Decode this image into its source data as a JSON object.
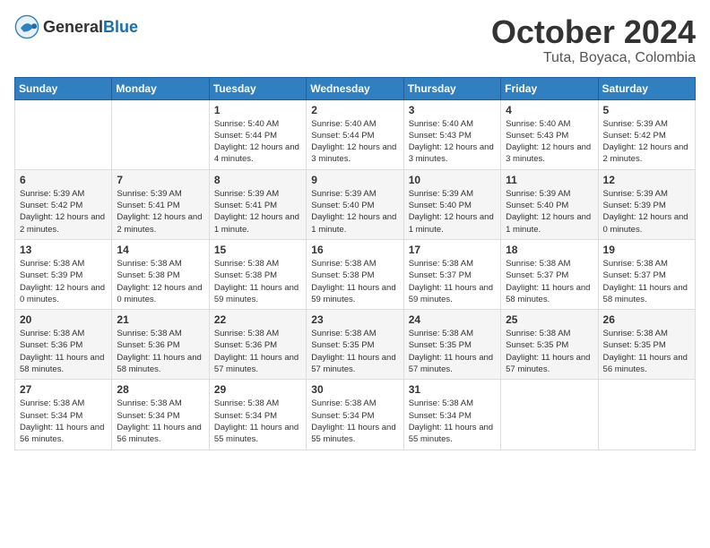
{
  "logo": {
    "general": "General",
    "blue": "Blue"
  },
  "header": {
    "month": "October 2024",
    "location": "Tuta, Boyaca, Colombia"
  },
  "days_of_week": [
    "Sunday",
    "Monday",
    "Tuesday",
    "Wednesday",
    "Thursday",
    "Friday",
    "Saturday"
  ],
  "weeks": [
    [
      {
        "day": "",
        "info": ""
      },
      {
        "day": "",
        "info": ""
      },
      {
        "day": "1",
        "info": "Sunrise: 5:40 AM\nSunset: 5:44 PM\nDaylight: 12 hours and 4 minutes."
      },
      {
        "day": "2",
        "info": "Sunrise: 5:40 AM\nSunset: 5:44 PM\nDaylight: 12 hours and 3 minutes."
      },
      {
        "day": "3",
        "info": "Sunrise: 5:40 AM\nSunset: 5:43 PM\nDaylight: 12 hours and 3 minutes."
      },
      {
        "day": "4",
        "info": "Sunrise: 5:40 AM\nSunset: 5:43 PM\nDaylight: 12 hours and 3 minutes."
      },
      {
        "day": "5",
        "info": "Sunrise: 5:39 AM\nSunset: 5:42 PM\nDaylight: 12 hours and 2 minutes."
      }
    ],
    [
      {
        "day": "6",
        "info": "Sunrise: 5:39 AM\nSunset: 5:42 PM\nDaylight: 12 hours and 2 minutes."
      },
      {
        "day": "7",
        "info": "Sunrise: 5:39 AM\nSunset: 5:41 PM\nDaylight: 12 hours and 2 minutes."
      },
      {
        "day": "8",
        "info": "Sunrise: 5:39 AM\nSunset: 5:41 PM\nDaylight: 12 hours and 1 minute."
      },
      {
        "day": "9",
        "info": "Sunrise: 5:39 AM\nSunset: 5:40 PM\nDaylight: 12 hours and 1 minute."
      },
      {
        "day": "10",
        "info": "Sunrise: 5:39 AM\nSunset: 5:40 PM\nDaylight: 12 hours and 1 minute."
      },
      {
        "day": "11",
        "info": "Sunrise: 5:39 AM\nSunset: 5:40 PM\nDaylight: 12 hours and 1 minute."
      },
      {
        "day": "12",
        "info": "Sunrise: 5:39 AM\nSunset: 5:39 PM\nDaylight: 12 hours and 0 minutes."
      }
    ],
    [
      {
        "day": "13",
        "info": "Sunrise: 5:38 AM\nSunset: 5:39 PM\nDaylight: 12 hours and 0 minutes."
      },
      {
        "day": "14",
        "info": "Sunrise: 5:38 AM\nSunset: 5:38 PM\nDaylight: 12 hours and 0 minutes."
      },
      {
        "day": "15",
        "info": "Sunrise: 5:38 AM\nSunset: 5:38 PM\nDaylight: 11 hours and 59 minutes."
      },
      {
        "day": "16",
        "info": "Sunrise: 5:38 AM\nSunset: 5:38 PM\nDaylight: 11 hours and 59 minutes."
      },
      {
        "day": "17",
        "info": "Sunrise: 5:38 AM\nSunset: 5:37 PM\nDaylight: 11 hours and 59 minutes."
      },
      {
        "day": "18",
        "info": "Sunrise: 5:38 AM\nSunset: 5:37 PM\nDaylight: 11 hours and 58 minutes."
      },
      {
        "day": "19",
        "info": "Sunrise: 5:38 AM\nSunset: 5:37 PM\nDaylight: 11 hours and 58 minutes."
      }
    ],
    [
      {
        "day": "20",
        "info": "Sunrise: 5:38 AM\nSunset: 5:36 PM\nDaylight: 11 hours and 58 minutes."
      },
      {
        "day": "21",
        "info": "Sunrise: 5:38 AM\nSunset: 5:36 PM\nDaylight: 11 hours and 58 minutes."
      },
      {
        "day": "22",
        "info": "Sunrise: 5:38 AM\nSunset: 5:36 PM\nDaylight: 11 hours and 57 minutes."
      },
      {
        "day": "23",
        "info": "Sunrise: 5:38 AM\nSunset: 5:35 PM\nDaylight: 11 hours and 57 minutes."
      },
      {
        "day": "24",
        "info": "Sunrise: 5:38 AM\nSunset: 5:35 PM\nDaylight: 11 hours and 57 minutes."
      },
      {
        "day": "25",
        "info": "Sunrise: 5:38 AM\nSunset: 5:35 PM\nDaylight: 11 hours and 57 minutes."
      },
      {
        "day": "26",
        "info": "Sunrise: 5:38 AM\nSunset: 5:35 PM\nDaylight: 11 hours and 56 minutes."
      }
    ],
    [
      {
        "day": "27",
        "info": "Sunrise: 5:38 AM\nSunset: 5:34 PM\nDaylight: 11 hours and 56 minutes."
      },
      {
        "day": "28",
        "info": "Sunrise: 5:38 AM\nSunset: 5:34 PM\nDaylight: 11 hours and 56 minutes."
      },
      {
        "day": "29",
        "info": "Sunrise: 5:38 AM\nSunset: 5:34 PM\nDaylight: 11 hours and 55 minutes."
      },
      {
        "day": "30",
        "info": "Sunrise: 5:38 AM\nSunset: 5:34 PM\nDaylight: 11 hours and 55 minutes."
      },
      {
        "day": "31",
        "info": "Sunrise: 5:38 AM\nSunset: 5:34 PM\nDaylight: 11 hours and 55 minutes."
      },
      {
        "day": "",
        "info": ""
      },
      {
        "day": "",
        "info": ""
      }
    ]
  ]
}
